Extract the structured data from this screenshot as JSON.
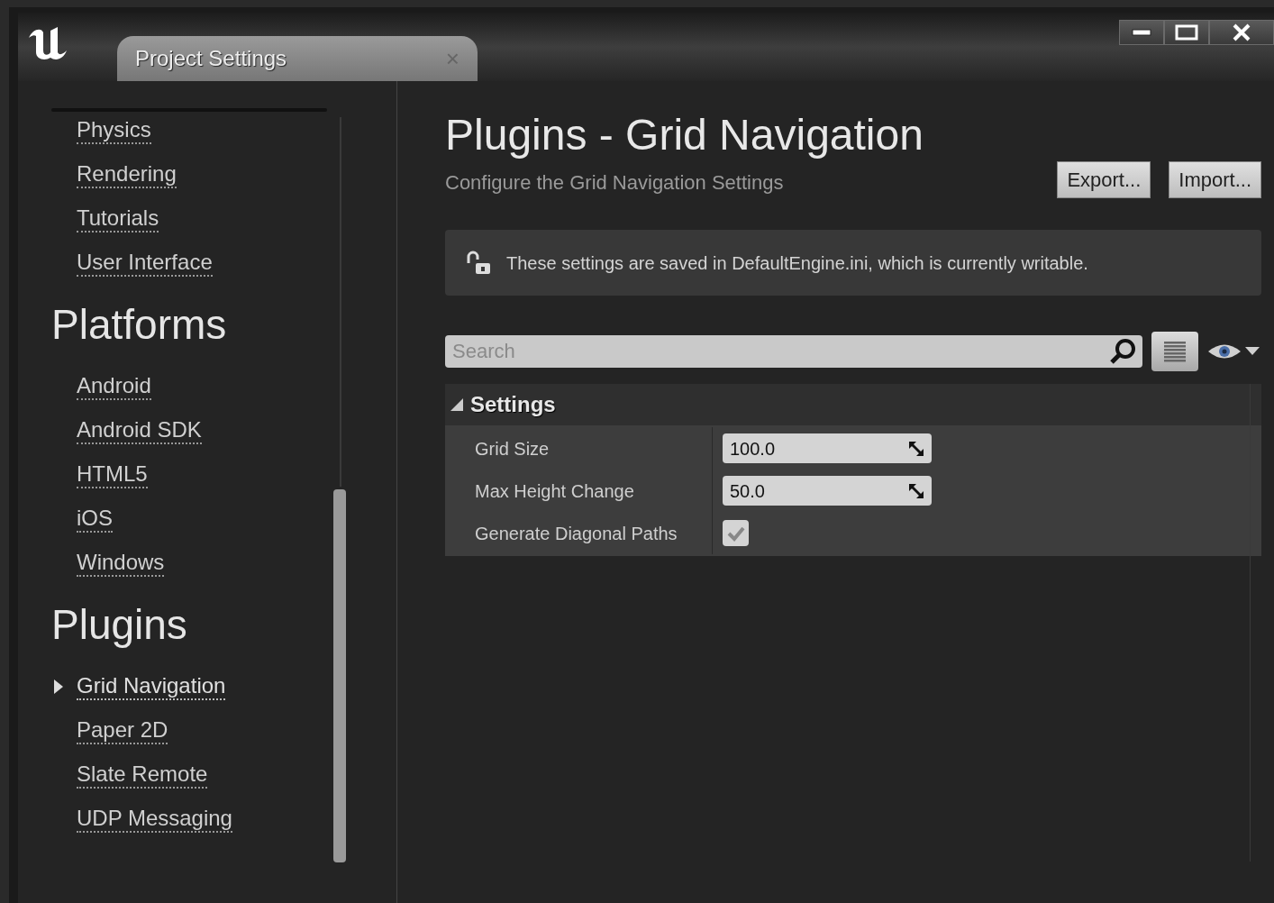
{
  "window": {
    "tab": {
      "title": "Project Settings",
      "close": "×"
    }
  },
  "sidebar": {
    "sections": [
      {
        "items": [
          {
            "label": "Physics",
            "selected": false
          },
          {
            "label": "Rendering",
            "selected": false
          },
          {
            "label": "Tutorials",
            "selected": false
          },
          {
            "label": "User Interface",
            "selected": false
          }
        ]
      },
      {
        "heading": "Platforms",
        "items": [
          {
            "label": "Android",
            "selected": false
          },
          {
            "label": "Android SDK",
            "selected": false
          },
          {
            "label": "HTML5",
            "selected": false
          },
          {
            "label": "iOS",
            "selected": false
          },
          {
            "label": "Windows",
            "selected": false
          }
        ]
      },
      {
        "heading": "Plugins",
        "items": [
          {
            "label": "Grid Navigation",
            "selected": true
          },
          {
            "label": "Paper 2D",
            "selected": false
          },
          {
            "label": "Slate Remote",
            "selected": false
          },
          {
            "label": "UDP Messaging",
            "selected": false
          }
        ]
      }
    ]
  },
  "page": {
    "title": "Plugins - Grid Navigation",
    "subtitle": "Configure the Grid Navigation Settings",
    "buttons": [
      "Export...",
      "Import..."
    ],
    "notice": "These settings are saved in DefaultEngine.ini, which is currently writable.",
    "search": {
      "placeholder": "Search"
    },
    "category": {
      "title": "Settings",
      "expanded": true,
      "rows": [
        {
          "kind": "number",
          "label": "Grid Size",
          "value": "100.0"
        },
        {
          "kind": "number",
          "label": "Max Height Change",
          "value": "50.0"
        },
        {
          "kind": "checkbox",
          "label": "Generate Diagonal Paths",
          "checked": true
        }
      ]
    }
  }
}
